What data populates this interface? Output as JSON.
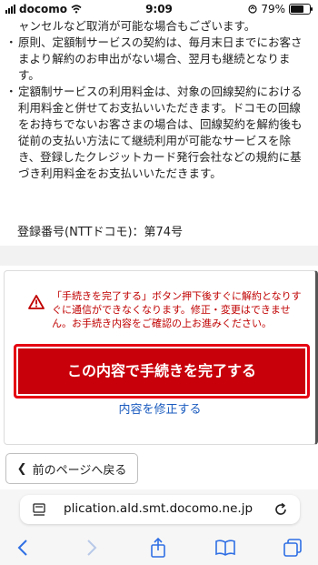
{
  "status": {
    "carrier": "docomo",
    "time": "9:09",
    "battery": "79%",
    "battery_level": 0.79
  },
  "terms": {
    "line1_partial": "ャンセルなど取消が可能な場合もございます。",
    "item_monthly": "原則、定額制サービスの契約は、毎月末日までにお客さまより解約のお申出がない場合、翌月も継続となります。",
    "item_fee": "定額制サービスの利用料金は、対象の回線契約における利用料金と併せてお支払いいただきます。ドコモの回線をお持ちでないお客さまの場合は、回線契約を解約後も従前の支払い方法にて継続利用が可能なサービスを除き、登録したクレジットカード発行会社などの規約に基づき利用料金をお支払いいただきます。",
    "registration": "登録番号(NTTドコモ)：第74号"
  },
  "action": {
    "alert": "「手続きを完了する」ボタン押下後すぐに解約となりすぐに通信ができなくなります。修正・変更はできません。お手続き内容をご確認の上お進みください。",
    "complete_button": "この内容で手続きを完了する",
    "edit_link": "内容を修正する"
  },
  "nav": {
    "back_button": "前のページへ戻る"
  },
  "browser": {
    "url": "plication.ald.smt.docomo.ne.jp"
  },
  "icons": {
    "alert": "warning-triangle-icon",
    "page": "page-settings-icon",
    "reload": "reload-icon",
    "back": "back-arrow-icon",
    "forward": "forward-arrow-icon",
    "share": "share-icon",
    "bookmarks": "bookmarks-icon",
    "tabs": "tabs-icon"
  },
  "colors": {
    "brand_red": "#c8000a",
    "alert_red": "#c00000",
    "link_blue": "#1a5bbf",
    "toolbar_blue": "#2f6fe4"
  }
}
